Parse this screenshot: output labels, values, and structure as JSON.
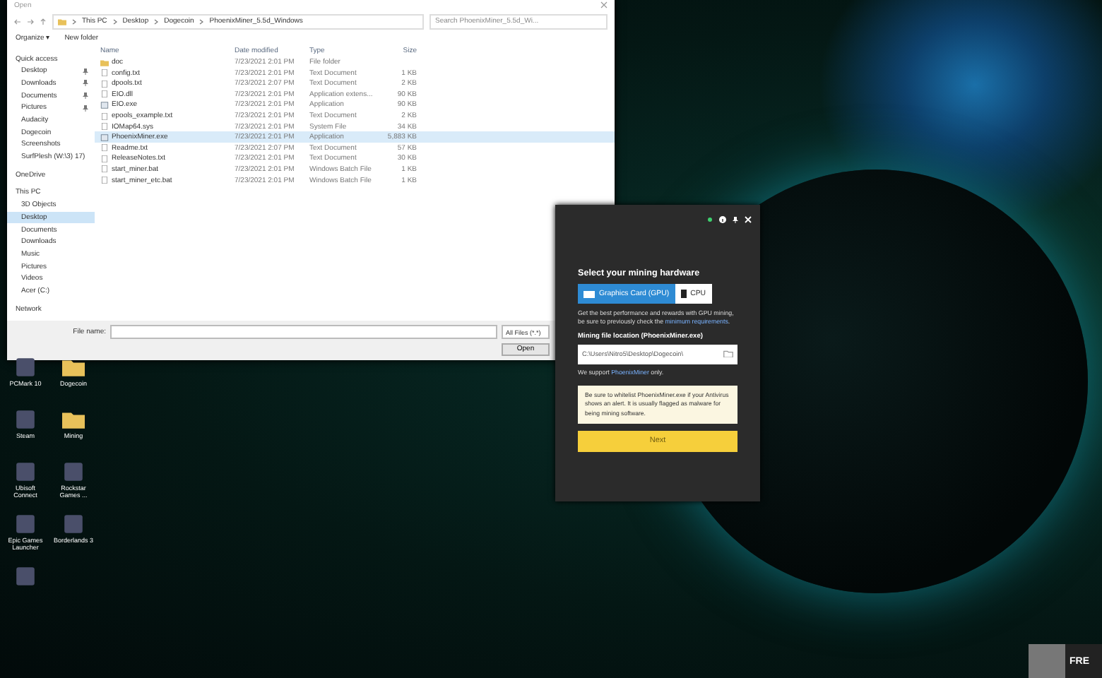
{
  "dialog": {
    "title": "Open",
    "path": [
      "This PC",
      "Desktop",
      "Dogecoin",
      "PhoenixMiner_5.5d_Windows"
    ],
    "search": {
      "placeholder": "Search PhoenixMiner_5.5d_Wi..."
    },
    "toolbar": [
      "Organize ▾",
      "New folder"
    ],
    "sidebar": [
      {
        "label": "Quick access",
        "selected": false,
        "children": [
          {
            "label": "Desktop",
            "selected": false,
            "pinned": true
          },
          {
            "label": "Downloads",
            "selected": false,
            "pinned": true
          },
          {
            "label": "Documents",
            "selected": false,
            "pinned": true
          },
          {
            "label": "Pictures",
            "selected": false,
            "pinned": true
          },
          {
            "label": "Audacity",
            "selected": false,
            "pinned": false
          },
          {
            "label": "Dogecoin",
            "selected": false,
            "pinned": false
          },
          {
            "label": "Screenshots",
            "selected": false,
            "pinned": false
          },
          {
            "label": "SurfPlesh (W:\\3) 17)",
            "selected": false,
            "pinned": false
          }
        ]
      },
      {
        "label": "OneDrive",
        "selected": false
      },
      {
        "label": "This PC",
        "selected": false,
        "children": [
          {
            "label": "3D Objects",
            "selected": false,
            "pinned": false
          },
          {
            "label": "Desktop",
            "selected": true,
            "pinned": false
          },
          {
            "label": "Documents",
            "selected": false,
            "pinned": false
          },
          {
            "label": "Downloads",
            "selected": false,
            "pinned": false
          },
          {
            "label": "Music",
            "selected": false,
            "pinned": false
          },
          {
            "label": "Pictures",
            "selected": false,
            "pinned": false
          },
          {
            "label": "Videos",
            "selected": false,
            "pinned": false
          },
          {
            "label": "Acer (C:)",
            "selected": false,
            "pinned": false
          }
        ]
      },
      {
        "label": "Network",
        "selected": false
      }
    ],
    "columns": [
      "Name",
      "Date modified",
      "Type",
      "Size"
    ],
    "files": [
      {
        "name": "doc",
        "date": "7/23/2021 2:01 PM",
        "type": "File folder",
        "kind": "folder",
        "selected": false
      },
      {
        "name": "config.txt",
        "date": "7/23/2021 2:01 PM",
        "type": "Text Document",
        "size": "1 KB",
        "kind": "file",
        "selected": false
      },
      {
        "name": "dpools.txt",
        "date": "7/23/2021 2:07 PM",
        "type": "Text Document",
        "size": "2 KB",
        "kind": "file",
        "selected": false
      },
      {
        "name": "EIO.dll",
        "date": "7/23/2021 2:01 PM",
        "type": "Application extens...",
        "size": "90 KB",
        "kind": "file",
        "selected": false
      },
      {
        "name": "EIO.exe",
        "date": "7/23/2021 2:01 PM",
        "type": "Application",
        "size": "90 KB",
        "kind": "app",
        "selected": false
      },
      {
        "name": "epools_example.txt",
        "date": "7/23/2021 2:01 PM",
        "type": "Text Document",
        "size": "2 KB",
        "kind": "file",
        "selected": false
      },
      {
        "name": "IOMap64.sys",
        "date": "7/23/2021 2:01 PM",
        "type": "System File",
        "size": "34 KB",
        "kind": "file",
        "selected": false
      },
      {
        "name": "PhoenixMiner.exe",
        "date": "7/23/2021 2:01 PM",
        "type": "Application",
        "size": "5,883 KB",
        "kind": "app",
        "selected": true
      },
      {
        "name": "Readme.txt",
        "date": "7/23/2021 2:07 PM",
        "type": "Text Document",
        "size": "57 KB",
        "kind": "file",
        "selected": false
      },
      {
        "name": "ReleaseNotes.txt",
        "date": "7/23/2021 2:01 PM",
        "type": "Text Document",
        "size": "30 KB",
        "kind": "file",
        "selected": false
      },
      {
        "name": "start_miner.bat",
        "date": "7/23/2021 2:01 PM",
        "type": "Windows Batch File",
        "size": "1 KB",
        "kind": "file",
        "selected": false
      },
      {
        "name": "start_miner_etc.bat",
        "date": "7/23/2021 2:01 PM",
        "type": "Windows Batch File",
        "size": "1 KB",
        "kind": "file",
        "selected": false
      }
    ],
    "file_name_label": "File name:",
    "filter": "All Files (*.*)",
    "open_button": "Open"
  },
  "miner": {
    "heading": "Select your mining hardware",
    "hardware": [
      {
        "label": "Graphics Card (GPU)",
        "selected": true
      },
      {
        "label": "CPU",
        "selected": false
      }
    ],
    "info": "Get the best performance and rewards with GPU mining, be sure to previously check the ",
    "info_link": "minimum requirements",
    "info_end": ".",
    "file_label": "Mining file location (PhoenixMiner.exe)",
    "file_value": "C:\\Users\\Nitro5\\Desktop\\Dogecoin\\",
    "support": "We support ",
    "support_link": "PhoenixMiner",
    "support_end": " only.",
    "warning": "Be sure to whitelist PhoenixMiner.exe if your Antivirus shows an alert. It is usually flagged as malware for being mining software.",
    "next_button": "Next"
  },
  "desktop_icons": [
    {
      "label": "PCMark 10",
      "kind": "app"
    },
    {
      "label": "Dogecoin",
      "kind": "folder"
    },
    {
      "label": "Steam",
      "kind": "app"
    },
    {
      "label": "Mining",
      "kind": "folder"
    },
    {
      "label": "Ubisoft Connect",
      "kind": "app"
    },
    {
      "label": "Rockstar Games ...",
      "kind": "app"
    },
    {
      "label": "Epic Games Launcher",
      "kind": "app"
    },
    {
      "label": "Borderlands 3",
      "kind": "app"
    },
    {
      "kind": "app"
    }
  ],
  "thumbnail_text": "FRE"
}
